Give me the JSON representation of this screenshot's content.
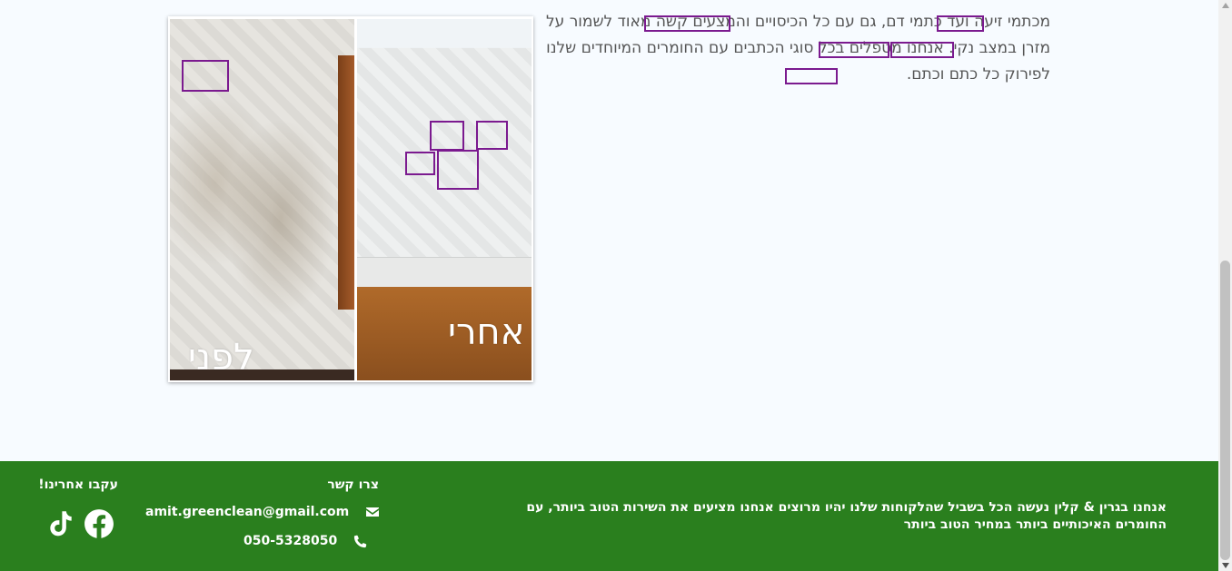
{
  "article": {
    "paragraph": "מכתמי זיעה ועד כתמי דם, גם עם כל הכיסויים והמצעים קשה מאוד לשמור על מזרן במצב נקי. אנחנו מטפלים בכל סוגי הכתבים עם החומרים המיוחדים שלנו לפירוק כל כתם וכתם."
  },
  "image": {
    "before_label": "לפני",
    "after_label": "אחרי"
  },
  "footer": {
    "about": "אנחנו בגרין & קלין נעשה הכל בשביל שהלקוחות שלנו יהיו מרוצים אנחנו מציעים את השירות הטוב ביותר, עם החומרים האיכותיים ביותר במחיר הטוב ביותר",
    "contact_title": "צרו קשר",
    "email": "amit.greenclean@gmail.com",
    "phone": "050-5328050",
    "follow_title": "עקבו אחרינו!",
    "icons": {
      "email": "envelope-icon",
      "phone": "phone-icon",
      "facebook": "facebook-icon",
      "tiktok": "tiktok-icon"
    }
  },
  "colors": {
    "footer_bg": "#2a7f1e",
    "highlight": "#7b1a8f",
    "page_bg": "#f7fbff"
  }
}
